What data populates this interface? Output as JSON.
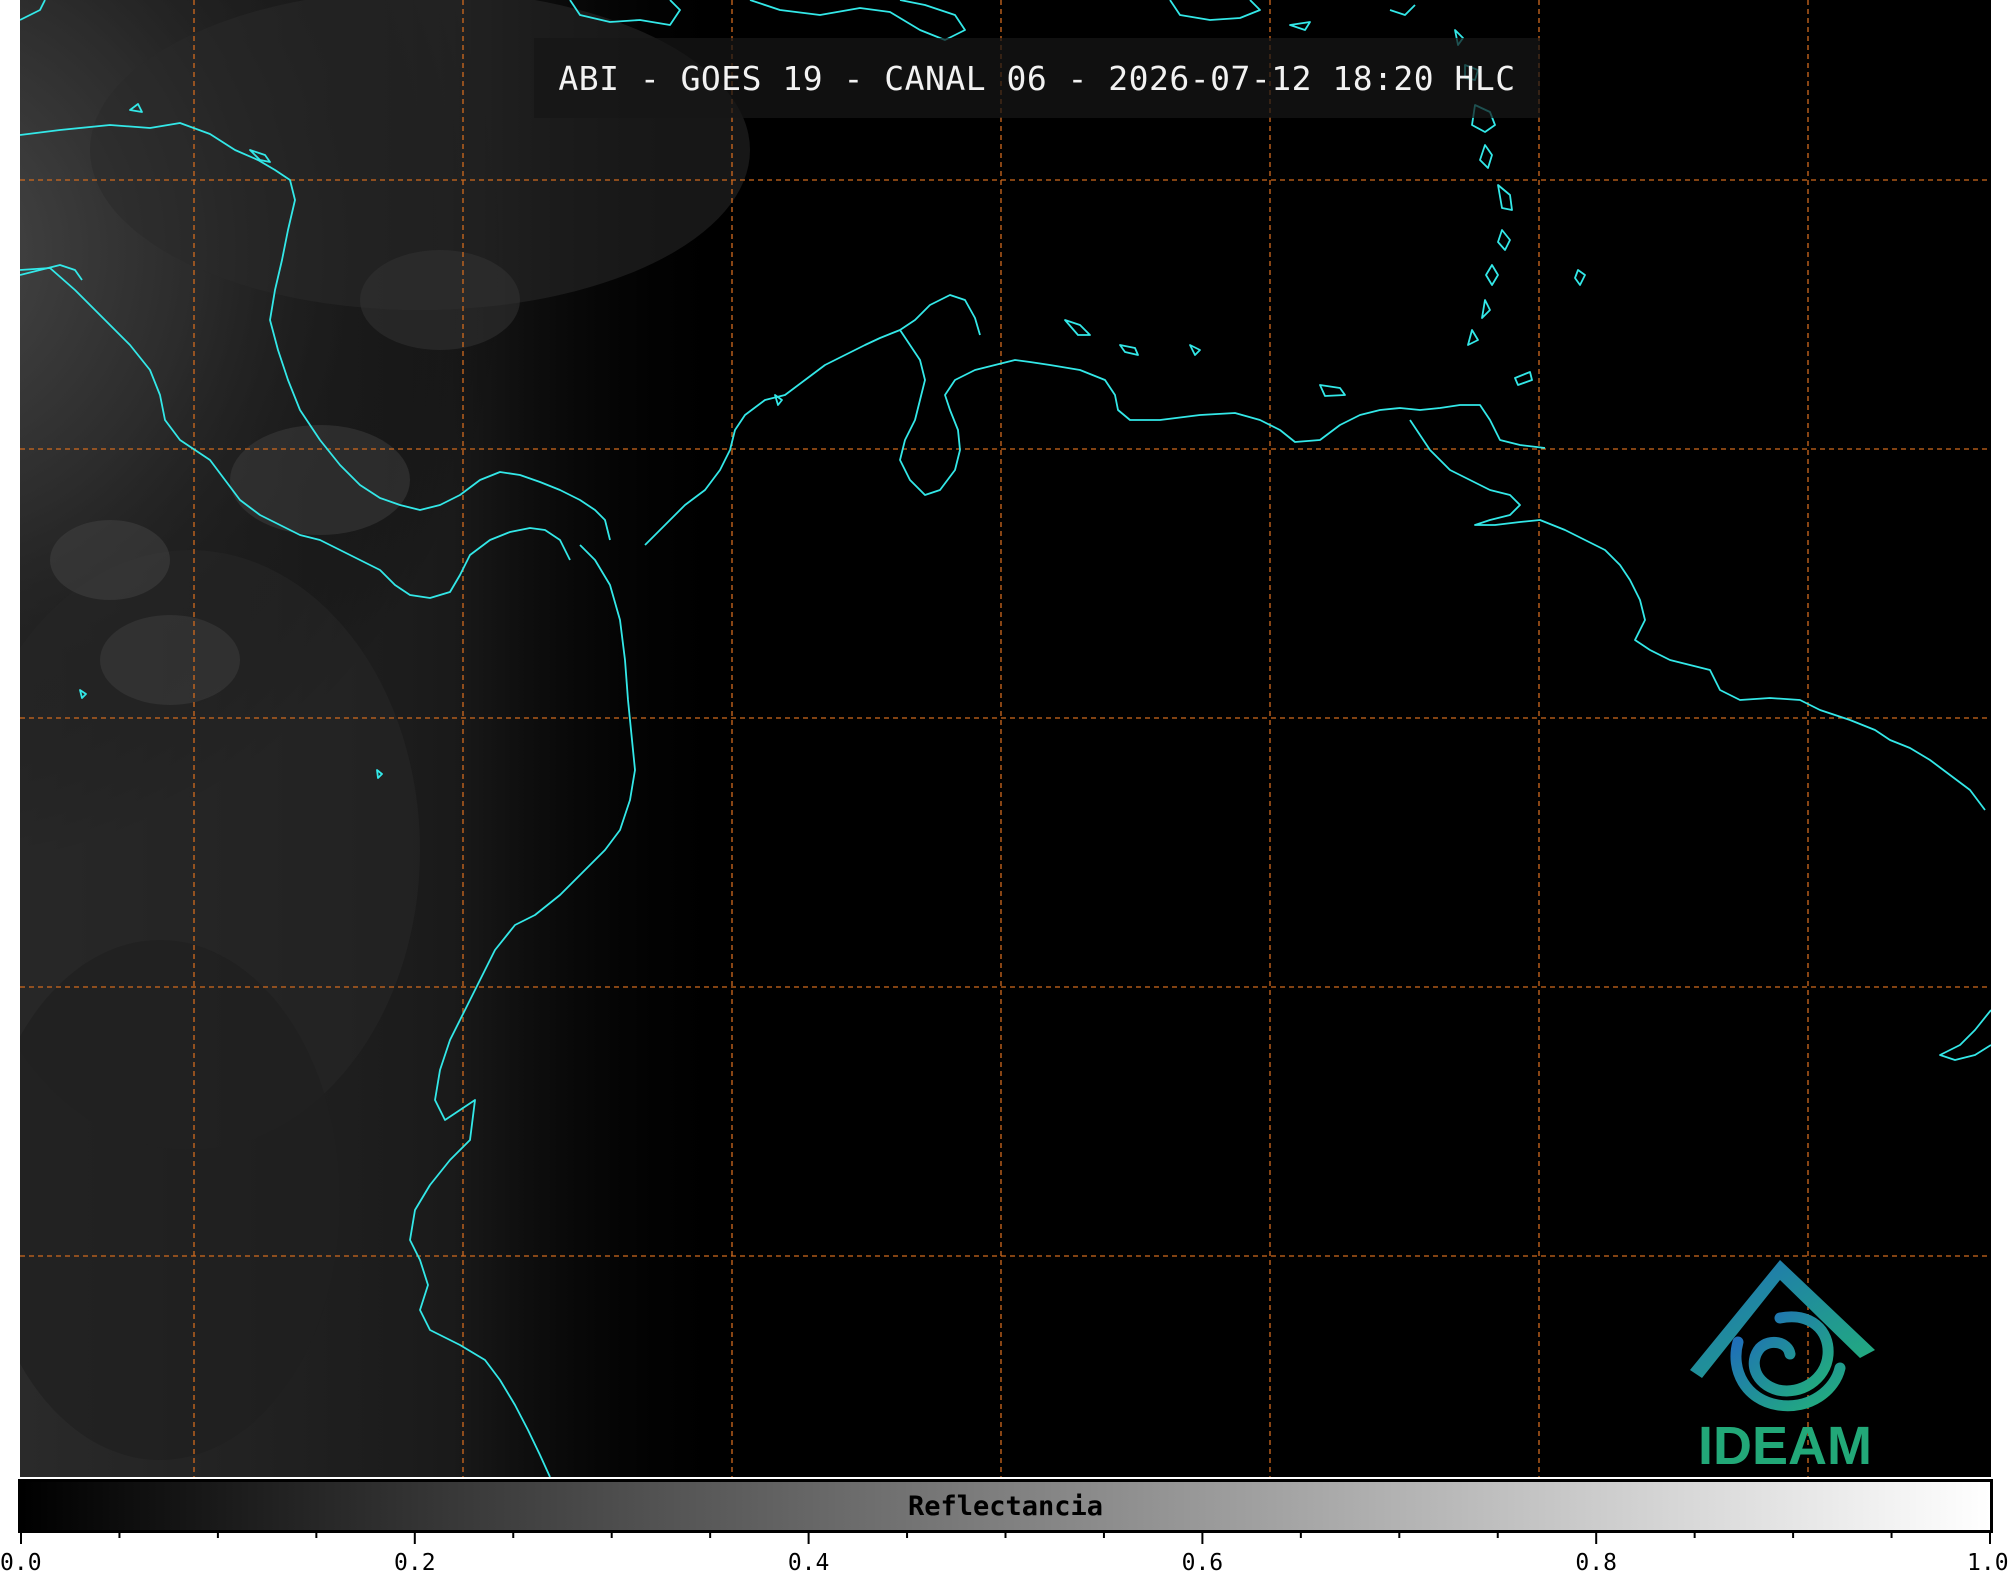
{
  "title": "ABI - GOES 19 - CANAL 06 - 2026-07-12 18:20 HLC",
  "colorbar": {
    "label": "Reflectancia",
    "range": [
      0.0,
      1.0
    ],
    "major_ticks": [
      "0.0",
      "0.2",
      "0.4",
      "0.6",
      "0.8",
      "1.0"
    ],
    "minor_step": 0.05,
    "colormap": "grayscale",
    "low_color": "#000000",
    "high_color": "#ffffff"
  },
  "logo": {
    "name": "ideam-logo-icon",
    "text": "IDEAM",
    "color": "#22a878"
  },
  "map": {
    "coastline_color": "#33e8e8",
    "grid_color": "#d06a1e",
    "grid_style": "dashed",
    "background_color": "#000000"
  }
}
